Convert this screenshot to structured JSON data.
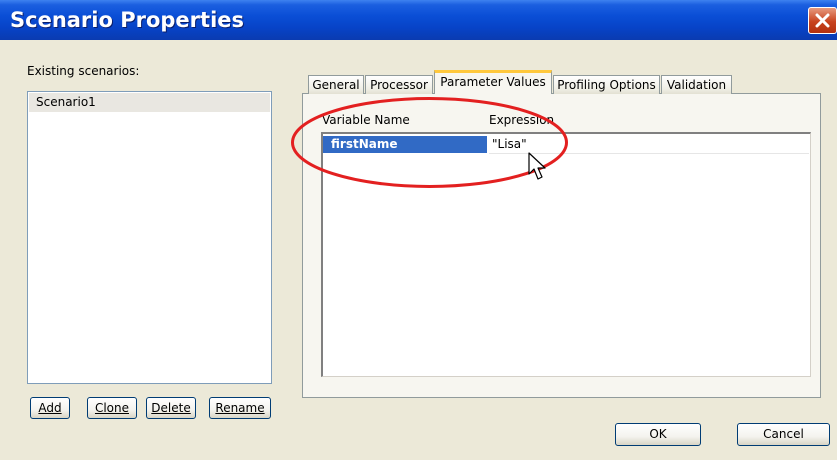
{
  "window": {
    "title": "Scenario Properties"
  },
  "left": {
    "label": "Existing scenarios:",
    "scenarios": [
      "Scenario1"
    ],
    "buttons": {
      "add": "Add",
      "clone": "Clone",
      "delete": "Delete",
      "rename": "Rename"
    }
  },
  "tabs": [
    "General",
    "Processor",
    "Parameter Values",
    "Profiling Options",
    "Validation"
  ],
  "active_tab": "Parameter Values",
  "grid": {
    "headers": {
      "name": "Variable Name",
      "expression": "Expression"
    },
    "rows": [
      {
        "name": "firstName",
        "expression": "\"Lisa\""
      }
    ]
  },
  "footer": {
    "ok": "OK",
    "cancel": "Cancel"
  },
  "colors": {
    "titlebar": "#0A4ED6",
    "selection": "#316AC5",
    "highlight_ellipse": "#E32020",
    "active_tab_accent": "#FFC83C"
  }
}
